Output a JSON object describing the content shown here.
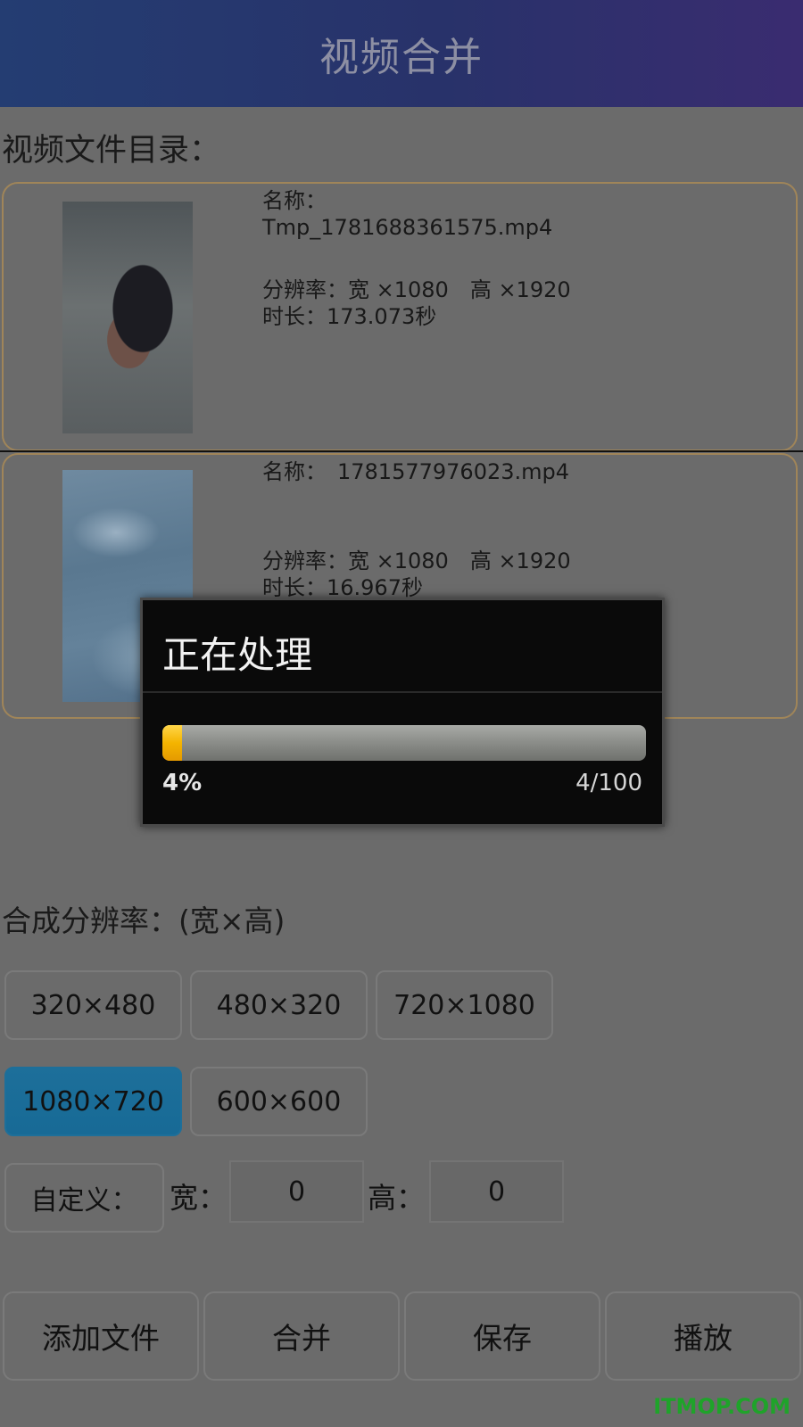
{
  "header": {
    "title": "视频合并"
  },
  "file_list": {
    "label": "视频文件目录：",
    "items": [
      {
        "name_label": "名称：",
        "name": "Tmp_1781688361575.mp4",
        "resolution": "分辨率：宽 ×1080　高 ×1920",
        "duration": "时长：173.073秒"
      },
      {
        "name_label": "名称：",
        "name": "1781577976023.mp4",
        "resolution": "分辨率：宽 ×1080　高 ×1920",
        "duration": "时长：16.967秒"
      }
    ]
  },
  "resolution": {
    "label": "合成分辨率：(宽×高)",
    "options": [
      "320×480",
      "480×320",
      "720×1080",
      "1080×720",
      "600×600"
    ],
    "selected": "1080×720",
    "custom_label": "自定义：",
    "width_label": "宽：",
    "width_value": "0",
    "height_label": "高：",
    "height_value": "0"
  },
  "actions": {
    "add": "添加文件",
    "merge": "合并",
    "save": "保存",
    "play": "播放"
  },
  "dialog": {
    "title": "正在处理",
    "progress": 0.04,
    "percent_text": "4%",
    "count_text": "4/100"
  },
  "colors": {
    "progress": "#f4b400",
    "selected": "#1d6f9a",
    "watermark": "#1fa32a"
  },
  "watermark": "ITMOP.COM"
}
